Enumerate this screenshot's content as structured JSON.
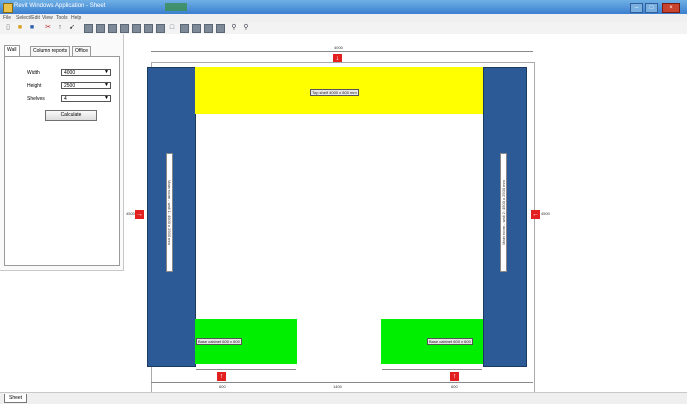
{
  "window": {
    "title": "Revit Windows Application - Sheet"
  },
  "menu": [
    "File",
    "Select/Edit",
    "View",
    "Tools",
    "Help"
  ],
  "panel": {
    "tabs": [
      "Wall",
      "Column reports",
      "Office"
    ],
    "fields": [
      {
        "label": "Width",
        "value": "4000"
      },
      {
        "label": "Height",
        "value": "2500"
      },
      {
        "label": "Shelves",
        "value": "4"
      }
    ],
    "calculate_label": "Calculate"
  },
  "drawing": {
    "top_dim": "4000",
    "left_dim": "4500",
    "right_dim": "4500",
    "bottom_left_dim": "600",
    "bottom_mid_dim": "1400",
    "bottom_right_dim": "600",
    "left_wall_label": "Main room - wall 1: 4500 x 2500 mm",
    "right_wall_label": "Main room - wall 2: 4500 x 2500 mm",
    "top_label": "Top shelf 4000 x 800 mm",
    "green_left_label": "Base cabinet 600 x 600",
    "green_right_label": "Base cabinet 600 x 600"
  },
  "colors": {
    "wall": "#2c5a96",
    "top": "#ffff00",
    "base": "#00ee00",
    "marker": "#e22020"
  },
  "status": {
    "sheet_tab": "Sheet"
  }
}
